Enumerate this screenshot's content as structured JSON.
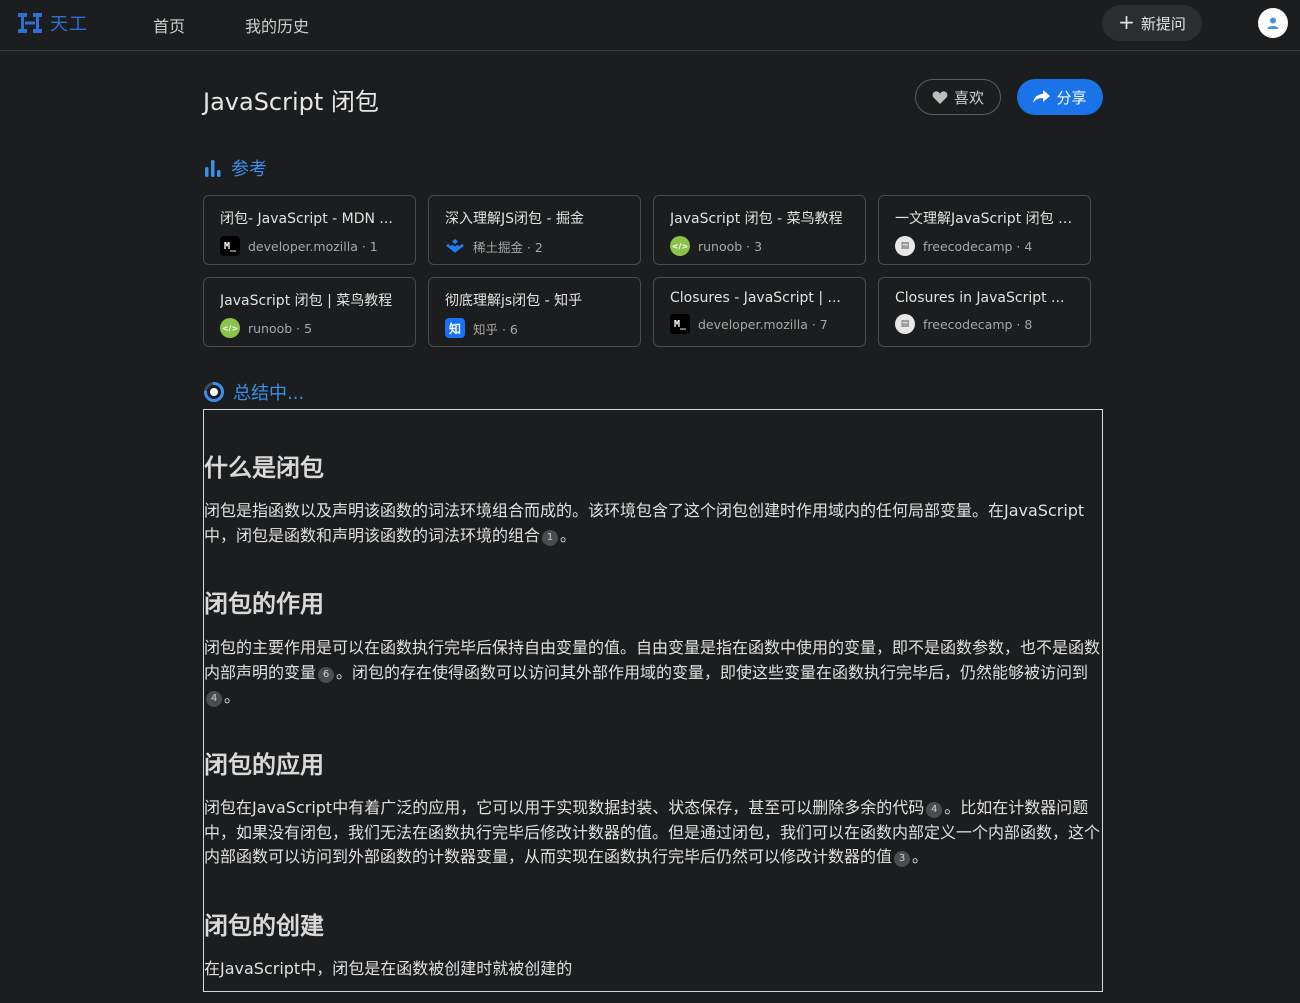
{
  "app": {
    "logo_text": "天工"
  },
  "nav": {
    "home": "首页",
    "history": "我的历史"
  },
  "header": {
    "new_question": "新提问"
  },
  "page": {
    "title": "JavaScript 闭包",
    "like": "喜欢",
    "share": "分享"
  },
  "references": {
    "heading": "参考",
    "items": [
      {
        "title": "闭包- JavaScript - MDN ...",
        "source": "developer.mozilla · 1",
        "icon": "mdn-icon"
      },
      {
        "title": "深入理解JS闭包 - 掘金",
        "source": "稀土掘金 · 2",
        "icon": "juejin-icon"
      },
      {
        "title": "JavaScript 闭包 - 菜鸟教程",
        "source": "runoob · 3",
        "icon": "runoob-icon"
      },
      {
        "title": "一文理解JavaScript 闭包 - ...",
        "source": "freecodecamp · 4",
        "icon": "freecodecamp-icon"
      },
      {
        "title": "JavaScript 闭包 | 菜鸟教程",
        "source": "runoob · 5",
        "icon": "runoob-icon"
      },
      {
        "title": "彻底理解js闭包 - 知乎",
        "source": "知乎 · 6",
        "icon": "zhihu-icon"
      },
      {
        "title": "Closures - JavaScript | ...",
        "source": "developer.mozilla · 7",
        "icon": "mdn-icon"
      },
      {
        "title": "Closures in JavaScript ...",
        "source": "freecodecamp · 8",
        "icon": "freecodecamp-icon"
      }
    ]
  },
  "summary": {
    "heading": "总结中...",
    "sections": [
      {
        "title": "什么是闭包",
        "p1": "闭包是指函数以及声明该函数的词法环境组合而成的。该环境包含了这个闭包创建时作用域内的任何局部变量。在JavaScript中，闭包是函数和声明该函数的词法环境的组合",
        "c1": "1",
        "p1_end": "。"
      },
      {
        "title": "闭包的作用",
        "p1": "闭包的主要作用是可以在函数执行完毕后保持自由变量的值。自由变量是指在函数中使用的变量，即不是函数参数，也不是函数内部声明的变量",
        "c1": "6",
        "p2": "。闭包的存在使得函数可以访问其外部作用域的变量，即使这些变量在函数执行完毕后，仍然能够被访问到",
        "c2": "4",
        "p2_end": "。"
      },
      {
        "title": "闭包的应用",
        "p1": "闭包在JavaScript中有着广泛的应用，它可以用于实现数据封装、状态保存，甚至可以删除多余的代码",
        "c1": "4",
        "p2": "。比如在计数器问题中，如果没有闭包，我们无法在函数执行完毕后修改计数器的值。但是通过闭包，我们可以在函数内部定义一个内部函数，这个内部函数可以访问到外部函数的计数器变量，从而实现在函数执行完毕后仍然可以修改计数器的值",
        "c2": "3",
        "p2_end": "。"
      },
      {
        "title": "闭包的创建",
        "p1": "在JavaScript中，闭包是在函数被创建时就被创建的"
      }
    ]
  },
  "colors": {
    "accent": "#1a73e8",
    "link": "#3b8eea",
    "background": "#1b1d1e"
  }
}
